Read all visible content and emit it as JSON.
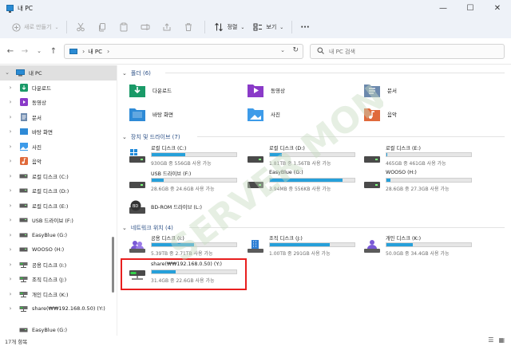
{
  "window": {
    "title": "내 PC",
    "minimize": "—",
    "maximize": "☐",
    "close": "✕"
  },
  "toolbar": {
    "new_label": "새로 만들기",
    "sort_label": "정렬",
    "view_label": "보기",
    "more_label": "···"
  },
  "address": {
    "crumb": "내 PC",
    "separator": "›",
    "search_placeholder": "내 PC 검색"
  },
  "sidebar": {
    "items": [
      {
        "label": "내 PC",
        "icon": "pc-icon",
        "selected": true,
        "expanded": true
      },
      {
        "label": "다운로드",
        "icon": "download-icon"
      },
      {
        "label": "동영상",
        "icon": "video-icon"
      },
      {
        "label": "문서",
        "icon": "document-icon"
      },
      {
        "label": "바탕 화면",
        "icon": "desktop-icon"
      },
      {
        "label": "사진",
        "icon": "picture-icon"
      },
      {
        "label": "음악",
        "icon": "music-icon"
      },
      {
        "label": "로컬 디스크 (C:)",
        "icon": "drive-icon"
      },
      {
        "label": "로컬 디스크 (D:)",
        "icon": "drive-icon"
      },
      {
        "label": "로컬 디스크 (E:)",
        "icon": "drive-icon"
      },
      {
        "label": "USB 드라이브 (F:)",
        "icon": "drive-icon"
      },
      {
        "label": "EasyBlue (G:)",
        "icon": "drive-icon"
      },
      {
        "label": "WOOSO (H:)",
        "icon": "drive-icon"
      },
      {
        "label": "공용 디스크 (I:)",
        "icon": "network-drive-icon"
      },
      {
        "label": "조직 디스크 (J:)",
        "icon": "network-drive-icon"
      },
      {
        "label": "개인 디스크 (K:)",
        "icon": "network-drive-icon"
      },
      {
        "label": "share(₩₩192.168.0.50) (Y:)",
        "icon": "network-drive-icon"
      },
      {
        "label": "EasyBlue (G:)",
        "icon": "drive-icon"
      }
    ]
  },
  "groups": {
    "folders": {
      "title": "폴더 (6)"
    },
    "drives": {
      "title": "장치 및 드라이브 (7)"
    },
    "network": {
      "title": "네트워크 위치 (4)"
    }
  },
  "folders": [
    {
      "label": "다운로드",
      "icon": "download-folder-icon"
    },
    {
      "label": "동영상",
      "icon": "video-folder-icon"
    },
    {
      "label": "문서",
      "icon": "document-folder-icon"
    },
    {
      "label": "바탕 화면",
      "icon": "desktop-folder-icon"
    },
    {
      "label": "사진",
      "icon": "picture-folder-icon"
    },
    {
      "label": "음악",
      "icon": "music-folder-icon"
    }
  ],
  "drives": [
    {
      "name": "로컬 디스크 (C:)",
      "info": "930GB 중 556GB 사용 가능",
      "used_fraction": 0.4,
      "icon": "windows-drive-icon"
    },
    {
      "name": "로컬 디스크 (D:)",
      "info": "1.81TB 중 1.56TB 사용 가능",
      "used_fraction": 0.14,
      "icon": "drive-icon"
    },
    {
      "name": "로컬 디스크 (E:)",
      "info": "465GB 중 461GB 사용 가능",
      "used_fraction": 0.01,
      "icon": "drive-icon"
    },
    {
      "name": "USB 드라이브 (F:)",
      "info": "28.6GB 중 24.6GB 사용 가능",
      "used_fraction": 0.14,
      "icon": "drive-icon"
    },
    {
      "name": "EasyBlue (G:)",
      "info": "3.94MB 중 556KB 사용 가능",
      "used_fraction": 0.86,
      "icon": "drive-icon"
    },
    {
      "name": "WOOSO (H:)",
      "info": "28.6GB 중 27.3GB 사용 가능",
      "used_fraction": 0.05,
      "icon": "drive-icon"
    },
    {
      "name": "BD-ROM 드라이브 (L:)",
      "info": "",
      "used_fraction": null,
      "icon": "bdrom-icon"
    }
  ],
  "network": [
    {
      "name": "공용 디스크 (I:)",
      "info": "5.39TB 중 2.71TB 사용 가능",
      "used_fraction": 0.5,
      "icon": "users-share-icon"
    },
    {
      "name": "조직 디스크 (J:)",
      "info": "1.00TB 중 291GB 사용 가능",
      "used_fraction": 0.71,
      "icon": "building-share-icon"
    },
    {
      "name": "개인 디스크 (K:)",
      "info": "50.0GB 중 34.4GB 사용 가능",
      "used_fraction": 0.31,
      "icon": "person-share-icon"
    },
    {
      "name": "share(₩₩192.168.0.50) (Y:)",
      "info": "31.4GB 중 22.6GB 사용 가능",
      "used_fraction": 0.28,
      "icon": "network-drive-icon"
    }
  ],
  "status": {
    "count": "17개 항목"
  },
  "watermark": {
    "text": "SERVER MON"
  },
  "colors": {
    "accent": "#26a0da",
    "highlight": "#e81f1f",
    "group_title": "#2b4f86"
  }
}
